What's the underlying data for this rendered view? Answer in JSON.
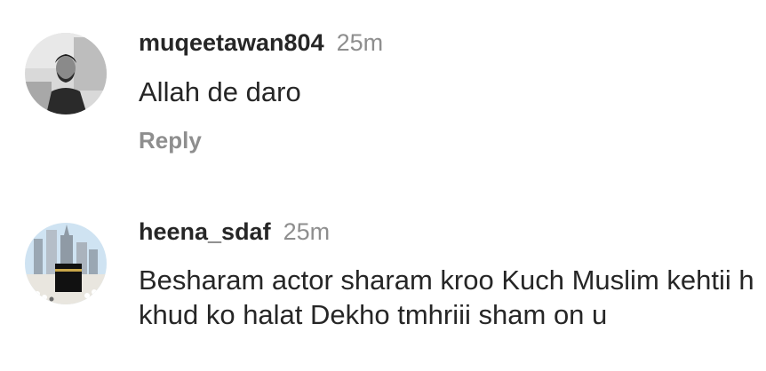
{
  "comments": [
    {
      "username": "muqeetawan804",
      "timestamp": "25m",
      "text": "Allah de daro",
      "reply_label": "Reply",
      "avatar_icon": "person-profile-photo"
    },
    {
      "username": "heena_sdaf",
      "timestamp": "25m",
      "text": "Besharam actor sharam kroo Kuch Muslim kehtii h khud ko halat Dekho tmhriii sham on u",
      "avatar_icon": "kaaba-mecca-photo"
    }
  ]
}
